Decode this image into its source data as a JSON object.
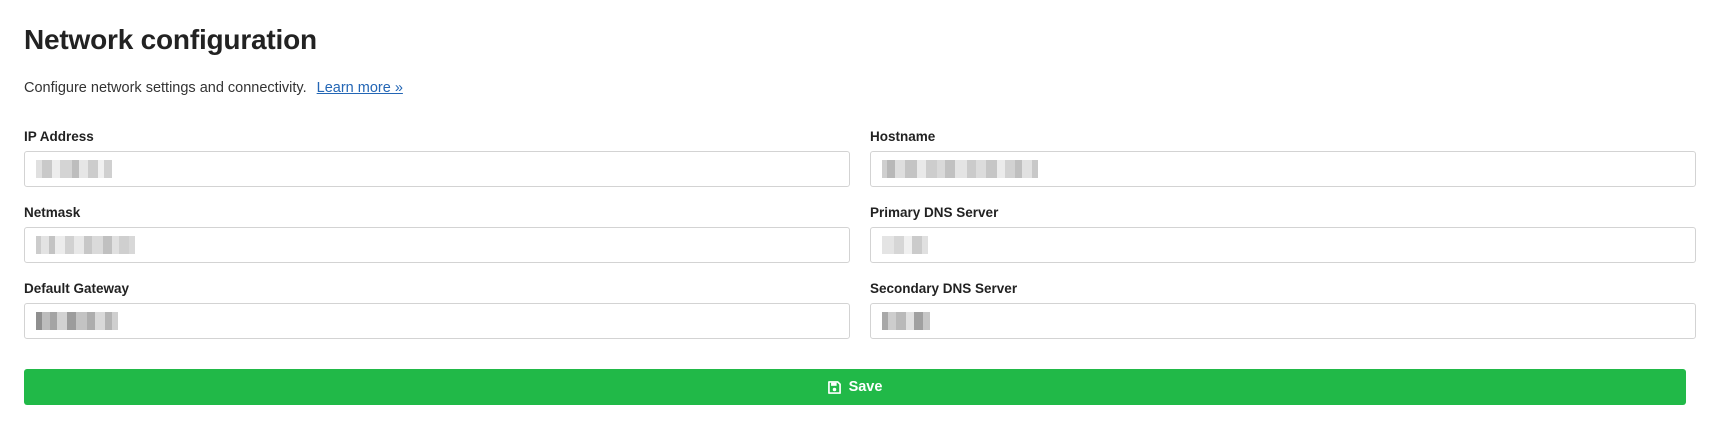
{
  "header": {
    "title": "Network configuration",
    "description": "Configure network settings and connectivity.",
    "learn_more": "Learn more »"
  },
  "form": {
    "ip_address": {
      "label": "IP Address",
      "value": ""
    },
    "hostname": {
      "label": "Hostname",
      "value": ""
    },
    "netmask": {
      "label": "Netmask",
      "value": ""
    },
    "primary_dns": {
      "label": "Primary DNS Server",
      "value": ""
    },
    "default_gateway": {
      "label": "Default Gateway",
      "value": ""
    },
    "secondary_dns": {
      "label": "Secondary DNS Server",
      "value": ""
    }
  },
  "actions": {
    "save_label": "Save",
    "save_icon": "floppy-disk-icon"
  },
  "colors": {
    "accent": "#21b948",
    "link": "#2366b5",
    "border": "#d3d3d3"
  }
}
